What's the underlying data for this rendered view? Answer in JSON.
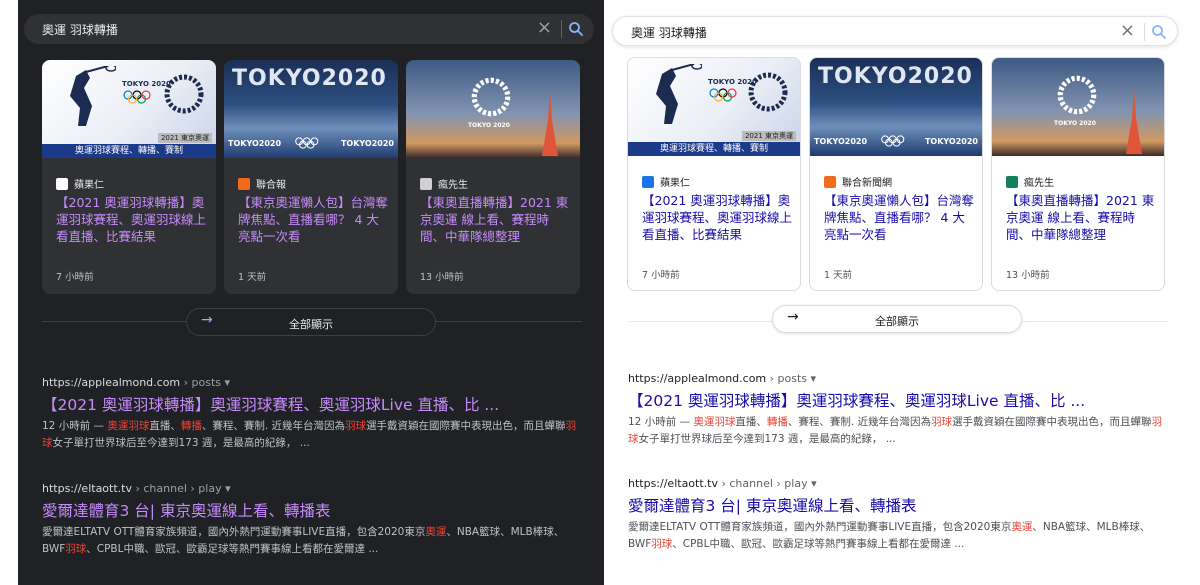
{
  "search": {
    "query": "奧運 羽球轉播"
  },
  "cards": [
    {
      "source": "蘋果仁",
      "title": "【2021 奧運羽球轉播】奧運羽球賽程、奧運羽球線上看直播、比賽結果",
      "time": "7 小時前",
      "thumb_caption": "奧運羽球賽程、轉播、賽制",
      "thumb_badge": "2021 東京奧運",
      "thumb_logo": "TOKYO 2020"
    },
    {
      "source": "聯合報",
      "title": "【東京奧運懶人包】台灣奪牌焦點、直播看哪？ 4 大亮點一次看",
      "time": "1 天前",
      "thumb_logo": "TOKYO2020"
    },
    {
      "source": "瘋先生",
      "title": "【東奧直播轉播】2021 東京奧運 線上看、賽程時間、中華隊總整理",
      "time": "13 小時前",
      "thumb_logo": "TOKYO 2020"
    }
  ],
  "cards_light_sources": [
    "蘋果仁",
    "聯合新聞網",
    "瘋先生"
  ],
  "show_all": {
    "label": "全部顯示"
  },
  "results": [
    {
      "domain": "https://applealmond.com",
      "path": " › posts",
      "title": "【2021 奧運羽球轉播】奧運羽球賽程、奧運羽球Live 直播、比 ...",
      "snippet_parts": [
        {
          "t": "12 小時前 — ",
          "h": false
        },
        {
          "t": "奧運羽球",
          "h": true
        },
        {
          "t": "直播、",
          "h": false
        },
        {
          "t": "轉播",
          "h": true
        },
        {
          "t": "、賽程、賽制. 近幾年台灣因為",
          "h": false
        },
        {
          "t": "羽球",
          "h": true
        },
        {
          "t": "選手戴資穎在國際賽中表現出色，而且蟬聯",
          "h": false
        },
        {
          "t": "羽球",
          "h": true
        },
        {
          "t": "女子單打世界球后至今達到173 週，是最高的紀錄， ...",
          "h": false
        }
      ]
    },
    {
      "domain": "https://eltaott.tv",
      "path": " › channel › play",
      "title": "愛爾達體育3 台| 東京奧運線上看、轉播表",
      "snippet_parts": [
        {
          "t": "愛爾達ELTATV OTT體育家族頻道，國內外熱門運動賽事LIVE直播，包含2020東京",
          "h": false
        },
        {
          "t": "奧運",
          "h": true
        },
        {
          "t": "、NBA籃球、MLB棒球、BWF",
          "h": false
        },
        {
          "t": "羽球",
          "h": true
        },
        {
          "t": "、CPBL中職、歐冠、歐霸足球等熱門賽事線上看都在愛爾達 ...",
          "h": false
        }
      ]
    }
  ],
  "colors": {
    "dark_bg": "#202124",
    "dark_card": "#303134",
    "dark_link": "#c58af9",
    "light_link": "#1a0dab",
    "highlight": "#ea4335",
    "search_icon": "#8ab4f8"
  }
}
